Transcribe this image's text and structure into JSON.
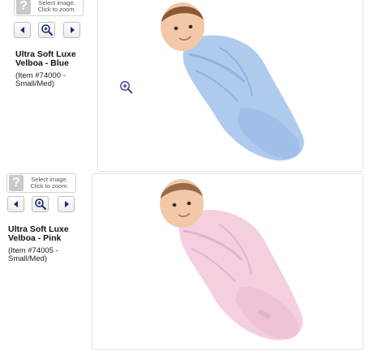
{
  "products": [
    {
      "id": "blue",
      "hint": {
        "line1": "Select image.",
        "line2": "Click to zoom."
      },
      "title": {
        "line1": "Ultra Soft Luxe",
        "line2": "Velboa - Blue"
      },
      "item": {
        "line1": "(Item #74000 -",
        "line2": "Small/Med)"
      },
      "swaddle_color": "#aecbee",
      "swaddle_shade": "#8fb1e0"
    },
    {
      "id": "pink",
      "hint": {
        "line1": "Select image.",
        "line2": "Click to zoom."
      },
      "title": {
        "line1": "Ultra Soft Luxe",
        "line2": "Velboa - Pink"
      },
      "item": {
        "line1": "(Item #74005 -",
        "line2": "Small/Med)"
      },
      "swaddle_color": "#f4cfe0",
      "swaddle_shade": "#e3b3ca"
    }
  ],
  "icons": {
    "hint": "question-mark-icon",
    "prev": "arrow-left-icon",
    "zoom": "magnifier-plus-icon",
    "next": "arrow-right-icon"
  },
  "colors": {
    "nav_arrow": "#1b2a6e",
    "zoom_overlay": "#4a4fa8",
    "skin": "#f2c9a8",
    "hair": "#8a5a38"
  }
}
